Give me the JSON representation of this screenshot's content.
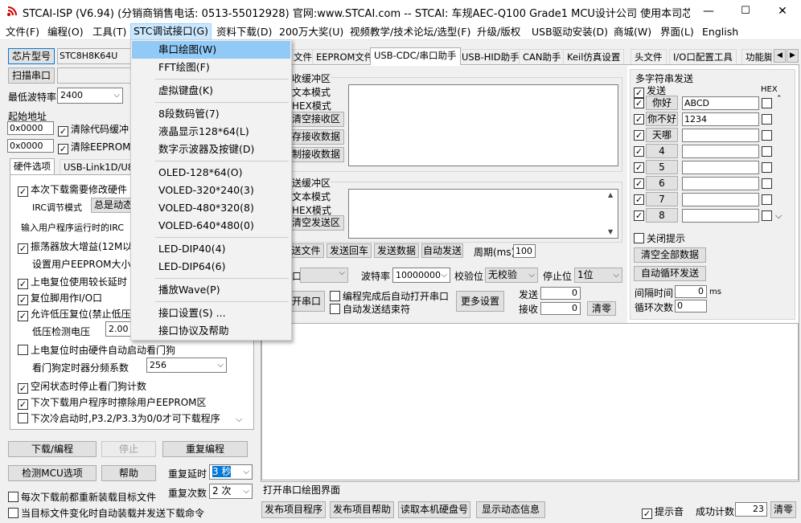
{
  "window": {
    "title": "STCAI-ISP (V6.94) (分销商销售电话: 0513-55012928) 官网:www.STCAI.com  -- STCAI: 车规AEC-Q100 Grade1 MCU设计公司 使用本司芯片或采购本...",
    "min": "—",
    "max": "☐",
    "close": "✕"
  },
  "menubar": [
    "文件(F)",
    "编程(O)",
    "工具(T)",
    "STC调试接口(G)",
    "资料下载(D)",
    "200万大奖(U)",
    "视频教学/技术论坛/选型(F)",
    "升级/版权",
    "USB驱动安装(D)",
    "商城(W)",
    "界面(L)",
    "English"
  ],
  "dropdown": {
    "items": [
      "串口绘图(W)",
      "FFT绘图(F)",
      "虚拟键盘(K)",
      "8段数码管(7)",
      "液晶显示128*64(L)",
      "数字示波器及按键(D)",
      "OLED-128*64(O)",
      "VOLED-320*240(3)",
      "VOLED-480*320(8)",
      "VOLED-640*480(0)",
      "LED-DIP40(4)",
      "LED-DIP64(6)",
      "播放Wave(P)",
      "接口设置(S) ...",
      "接口协议及帮助"
    ]
  },
  "left": {
    "chip_btn": "芯片型号",
    "chip_value": "STC8H8K64U",
    "scan_btn": "扫描串口",
    "baud_label": "最低波特率",
    "baud_value": "2400",
    "start_label": "起始地址",
    "addr1": "0x0000",
    "addr2": "0x0000",
    "clear_code": "清除代码缓冲",
    "clear_eeprom": "清除EEPROM缓",
    "tabs": [
      "硬件选项",
      "USB-Link1D/U8W"
    ],
    "opts": {
      "o1": "本次下载需要修改硬件",
      "irc_label": "IRC调节模式",
      "irc_value": "总是动态",
      "input_irc": "输入用户程序运行时的IRC",
      "o2": "振荡器放大增益(12M以",
      "eeprom_size": "设置用户EEPROM大小",
      "o3": "上电复位使用较长延时",
      "o4": "复位脚用作I/O口",
      "o5": "允许低压复位(禁止低压",
      "lv_label": "低压检测电压",
      "lv_value": "2.00",
      "o6": "上电复位时由硬件自动启动看门狗",
      "wdt_label": "看门狗定时器分频系数",
      "wdt_value": "256",
      "o7": "空闲状态时停止看门狗计数",
      "o8": "下次下载用户程序时擦除用户EEPROM区",
      "o9": "下次冷启动时,P3.2/P3.3为0/0才可下载程序"
    },
    "download_btn": "下载/编程",
    "stop_btn": "停止",
    "reprogram_btn": "重复编程",
    "detect_btn": "检测MCU选项",
    "help_btn": "帮助",
    "delay_label": "重复延时",
    "delay_value": "3 秒",
    "count_label": "重复次数",
    "count_value": "2 次",
    "reload_label": "每次下载前都重新装载目标文件",
    "auto_label": "当目标文件变化时自动装载并发送下载命令"
  },
  "tabs": [
    "文件",
    "EEPROM文件",
    "USB-CDC/串口助手",
    "USB-HID助手",
    "CAN助手",
    "Keil仿真设置",
    "头文件",
    "I/O口配置工具",
    "功能脚"
  ],
  "recv": {
    "title": "收缓冲区",
    "text_mode": "文本模式",
    "hex_mode": "HEX模式",
    "clear": "清空接收区",
    "save": "存接收数据",
    "copy": "制接收数据"
  },
  "send": {
    "title": "送缓冲区",
    "text_mode": "文本模式",
    "hex_mode": "HEX模式",
    "clear": "清空发送区"
  },
  "actions": {
    "send_file": "送文件",
    "send_back": "发送回车",
    "send_data": "发送数据",
    "auto_send": "自动发送",
    "period_label": "周期(ms)",
    "period": "100"
  },
  "serial": {
    "port_label": "口",
    "baud_label": "波特率",
    "baud": "10000000",
    "parity_label": "校验位",
    "parity": "无校验",
    "stop_label": "停止位",
    "stop": "1位",
    "open": "开串口",
    "auto_open": "编程完成后自动打开串口",
    "auto_end": "自动发送结束符",
    "more": "更多设置",
    "sent_label": "发送",
    "sent": "0",
    "recv_label": "接收",
    "recv": "0",
    "clear": "清零"
  },
  "multi": {
    "title": "多字符串发送",
    "send": "发送",
    "hex": "HEX",
    "rows": [
      {
        "btn": "你好",
        "val": "ABCD"
      },
      {
        "btn": "你不好",
        "val": "1234"
      },
      {
        "btn": "天哪",
        "val": ""
      },
      {
        "btn": "4",
        "val": ""
      },
      {
        "btn": "5",
        "val": ""
      },
      {
        "btn": "6",
        "val": ""
      },
      {
        "btn": "7",
        "val": ""
      },
      {
        "btn": "8",
        "val": ""
      }
    ],
    "close_hint": "关闭提示",
    "clear_all": "清空全部数据",
    "auto_loop": "自动循环发送",
    "interval_label": "间隔时间",
    "interval": "0",
    "ms": "ms",
    "loop_label": "循环次数",
    "loop": "0"
  },
  "status": {
    "text": "打开串口绘图界面"
  },
  "bottom": {
    "publish": "发布项目程序",
    "publish_help": "发布项目帮助",
    "read_disk": "读取本机硬盘号",
    "show_info": "显示动态信息",
    "beep": "提示音",
    "success_label": "成功计数",
    "success": "23",
    "clear": "清零"
  }
}
